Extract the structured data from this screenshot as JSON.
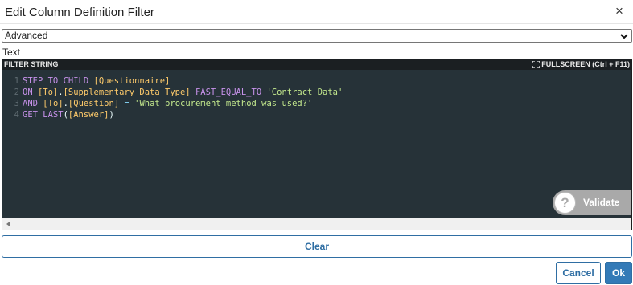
{
  "dialog": {
    "title": "Edit Column Definition Filter",
    "close_glyph": "×"
  },
  "mode_select": {
    "value": "Advanced",
    "icon": "chevron-down-icon"
  },
  "text_label": "Text",
  "editor": {
    "header_label": "FILTER STRING",
    "fullscreen_label": "FULLSCREEN (Ctrl + F11)",
    "fullscreen_icon": "expand-icon",
    "theme_colors": {
      "background": "#263238",
      "keyword": "#c792ea",
      "field": "#ffcb6b",
      "string": "#c3e88d"
    },
    "lines": [
      {
        "number": "1",
        "tokens": [
          {
            "t": "STEP TO CHILD ",
            "c": "kw"
          },
          {
            "t": "[Questionnaire]",
            "c": "fld"
          }
        ]
      },
      {
        "number": "2",
        "tokens": [
          {
            "t": "ON ",
            "c": "kw"
          },
          {
            "t": "[To]",
            "c": "fld"
          },
          {
            "t": ".",
            "c": "pl"
          },
          {
            "t": "[Supplementary Data Type]",
            "c": "fld"
          },
          {
            "t": " ",
            "c": "pl"
          },
          {
            "t": "FAST_EQUAL_TO",
            "c": "kw"
          },
          {
            "t": " ",
            "c": "pl"
          },
          {
            "t": "'Contract Data'",
            "c": "str"
          }
        ]
      },
      {
        "number": "3",
        "tokens": [
          {
            "t": "AND ",
            "c": "kw"
          },
          {
            "t": "[To]",
            "c": "fld"
          },
          {
            "t": ".",
            "c": "pl"
          },
          {
            "t": "[Question]",
            "c": "fld"
          },
          {
            "t": " ",
            "c": "pl"
          },
          {
            "t": "=",
            "c": "op"
          },
          {
            "t": " ",
            "c": "pl"
          },
          {
            "t": "'What procurement method was used?'",
            "c": "str"
          }
        ]
      },
      {
        "number": "4",
        "tokens": [
          {
            "t": "GET LAST",
            "c": "kw"
          },
          {
            "t": "(",
            "c": "pl"
          },
          {
            "t": "[Answer]",
            "c": "fld"
          },
          {
            "t": ")",
            "c": "pl"
          }
        ]
      }
    ],
    "validate": {
      "label": "Validate",
      "icon_glyph": "?",
      "icon": "question-icon"
    }
  },
  "buttons": {
    "clear": "Clear",
    "cancel": "Cancel",
    "ok": "Ok"
  }
}
